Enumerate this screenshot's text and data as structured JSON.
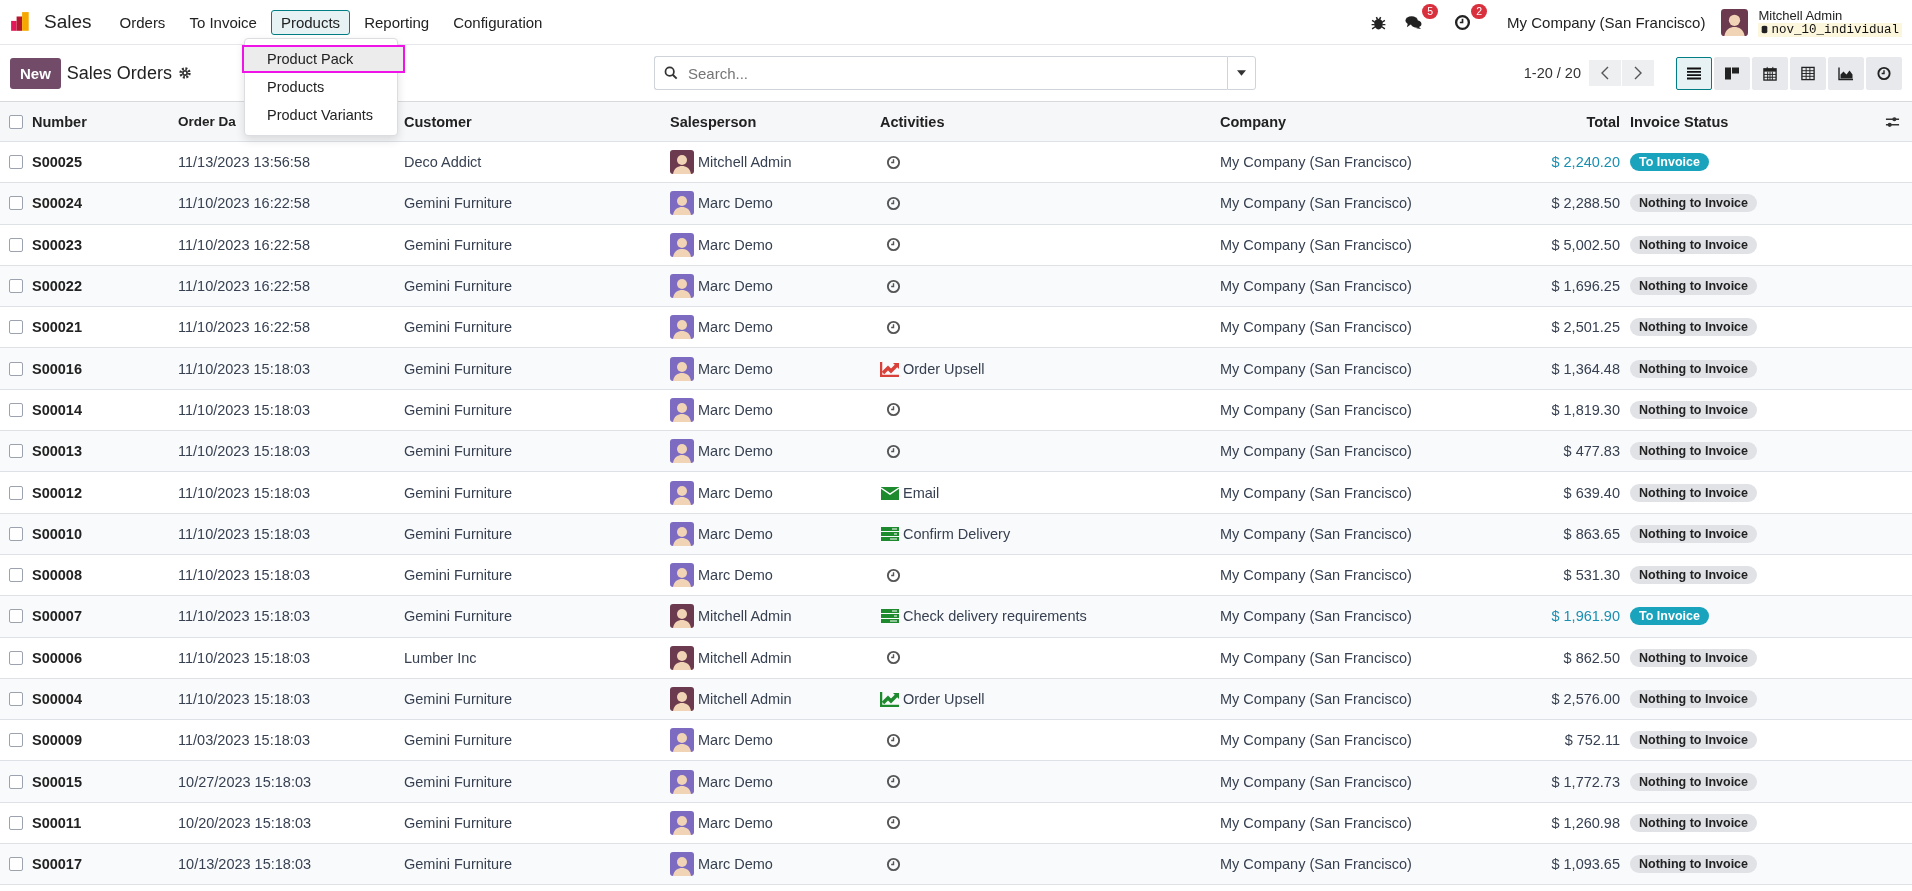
{
  "app": {
    "name": "Sales"
  },
  "menu": [
    {
      "label": "Orders",
      "selected": false
    },
    {
      "label": "To Invoice",
      "selected": false
    },
    {
      "label": "Products",
      "selected": true
    },
    {
      "label": "Reporting",
      "selected": false
    },
    {
      "label": "Configuration",
      "selected": false
    }
  ],
  "products_menu": [
    {
      "label": "Product Pack",
      "selected": true
    },
    {
      "label": "Products",
      "selected": false
    },
    {
      "label": "Product Variants",
      "selected": false
    }
  ],
  "systray": {
    "messages_count": "5",
    "activities_count": "2",
    "company": "My Company (San Francisco)",
    "user": "Mitchell Admin",
    "database": "nov_10_individual"
  },
  "control_panel": {
    "new_button": "New",
    "title": "Sales Orders",
    "search": {
      "placeholder": "Search..."
    },
    "pager": "1-20 / 20",
    "views": [
      {
        "kind": "list",
        "selected": true
      },
      {
        "kind": "kanban",
        "selected": false
      },
      {
        "kind": "calendar",
        "selected": false
      },
      {
        "kind": "pivot",
        "selected": false
      },
      {
        "kind": "graph",
        "selected": false
      },
      {
        "kind": "activity",
        "selected": false
      }
    ]
  },
  "table": {
    "select_all": {
      "checked": false
    },
    "columns": [
      "Number",
      "Order Da",
      "Customer",
      "Salesperson",
      "Activities",
      "Company",
      "Total",
      "Invoice Status"
    ],
    "rows": [
      {
        "checked": false,
        "number": "S00025",
        "order_date": "11/13/2023 13:56:58",
        "customer": "Deco Addict",
        "salesperson": "Mitchell Admin",
        "avatar": {
          "color": "#6b3a4f"
        },
        "activity": {
          "kind": "none"
        },
        "company": "My Company (San Francisco)",
        "total": "$ 2,240.20",
        "status": {
          "label": "To Invoice",
          "kind": "to_invoice"
        }
      },
      {
        "checked": false,
        "number": "S00024",
        "order_date": "11/10/2023 16:22:58",
        "customer": "Gemini Furniture",
        "salesperson": "Marc Demo",
        "avatar": {
          "color": "#7d6bc2"
        },
        "activity": {
          "kind": "none"
        },
        "company": "My Company (San Francisco)",
        "total": "$ 2,288.50",
        "status": {
          "label": "Nothing to Invoice",
          "kind": "nothing"
        }
      },
      {
        "checked": false,
        "number": "S00023",
        "order_date": "11/10/2023 16:22:58",
        "customer": "Gemini Furniture",
        "salesperson": "Marc Demo",
        "avatar": {
          "color": "#7d6bc2"
        },
        "activity": {
          "kind": "none"
        },
        "company": "My Company (San Francisco)",
        "total": "$ 5,002.50",
        "status": {
          "label": "Nothing to Invoice",
          "kind": "nothing"
        }
      },
      {
        "checked": false,
        "number": "S00022",
        "order_date": "11/10/2023 16:22:58",
        "customer": "Gemini Furniture",
        "salesperson": "Marc Demo",
        "avatar": {
          "color": "#7d6bc2"
        },
        "activity": {
          "kind": "none"
        },
        "company": "My Company (San Francisco)",
        "total": "$ 1,696.25",
        "status": {
          "label": "Nothing to Invoice",
          "kind": "nothing"
        }
      },
      {
        "checked": false,
        "number": "S00021",
        "order_date": "11/10/2023 16:22:58",
        "customer": "Gemini Furniture",
        "salesperson": "Marc Demo",
        "avatar": {
          "color": "#7d6bc2"
        },
        "activity": {
          "kind": "none"
        },
        "company": "My Company (San Francisco)",
        "total": "$ 2,501.25",
        "status": {
          "label": "Nothing to Invoice",
          "kind": "nothing"
        }
      },
      {
        "checked": false,
        "number": "S00016",
        "order_date": "11/10/2023 15:18:03",
        "customer": "Gemini Furniture",
        "salesperson": "Marc Demo",
        "avatar": {
          "color": "#7d6bc2"
        },
        "activity": {
          "kind": "upsell",
          "label": "Order Upsell",
          "color": "#d9403a"
        },
        "company": "My Company (San Francisco)",
        "total": "$ 1,364.48",
        "status": {
          "label": "Nothing to Invoice",
          "kind": "nothing"
        }
      },
      {
        "checked": false,
        "number": "S00014",
        "order_date": "11/10/2023 15:18:03",
        "customer": "Gemini Furniture",
        "salesperson": "Marc Demo",
        "avatar": {
          "color": "#7d6bc2"
        },
        "activity": {
          "kind": "none"
        },
        "company": "My Company (San Francisco)",
        "total": "$ 1,819.30",
        "status": {
          "label": "Nothing to Invoice",
          "kind": "nothing"
        }
      },
      {
        "checked": false,
        "number": "S00013",
        "order_date": "11/10/2023 15:18:03",
        "customer": "Gemini Furniture",
        "salesperson": "Marc Demo",
        "avatar": {
          "color": "#7d6bc2"
        },
        "activity": {
          "kind": "none"
        },
        "company": "My Company (San Francisco)",
        "total": "$ 477.83",
        "status": {
          "label": "Nothing to Invoice",
          "kind": "nothing"
        }
      },
      {
        "checked": false,
        "number": "S00012",
        "order_date": "11/10/2023 15:18:03",
        "customer": "Gemini Furniture",
        "salesperson": "Marc Demo",
        "avatar": {
          "color": "#7d6bc2"
        },
        "activity": {
          "kind": "email",
          "label": "Email",
          "color": "#1e8a2e"
        },
        "company": "My Company (San Francisco)",
        "total": "$ 639.40",
        "status": {
          "label": "Nothing to Invoice",
          "kind": "nothing"
        }
      },
      {
        "checked": false,
        "number": "S00010",
        "order_date": "11/10/2023 15:18:03",
        "customer": "Gemini Furniture",
        "salesperson": "Marc Demo",
        "avatar": {
          "color": "#7d6bc2"
        },
        "activity": {
          "kind": "todo",
          "label": "Confirm Delivery",
          "color": "#1e8a2e"
        },
        "company": "My Company (San Francisco)",
        "total": "$ 863.65",
        "status": {
          "label": "Nothing to Invoice",
          "kind": "nothing"
        }
      },
      {
        "checked": false,
        "number": "S00008",
        "order_date": "11/10/2023 15:18:03",
        "customer": "Gemini Furniture",
        "salesperson": "Marc Demo",
        "avatar": {
          "color": "#7d6bc2"
        },
        "activity": {
          "kind": "none"
        },
        "company": "My Company (San Francisco)",
        "total": "$ 531.30",
        "status": {
          "label": "Nothing to Invoice",
          "kind": "nothing"
        }
      },
      {
        "checked": false,
        "number": "S00007",
        "order_date": "11/10/2023 15:18:03",
        "customer": "Gemini Furniture",
        "salesperson": "Mitchell Admin",
        "avatar": {
          "color": "#6b3a4f"
        },
        "activity": {
          "kind": "todo",
          "label": "Check delivery requirements",
          "color": "#1e8a2e"
        },
        "company": "My Company (San Francisco)",
        "total": "$ 1,961.90",
        "status": {
          "label": "To Invoice",
          "kind": "to_invoice"
        }
      },
      {
        "checked": false,
        "number": "S00006",
        "order_date": "11/10/2023 15:18:03",
        "customer": "Lumber Inc",
        "salesperson": "Mitchell Admin",
        "avatar": {
          "color": "#6b3a4f"
        },
        "activity": {
          "kind": "none"
        },
        "company": "My Company (San Francisco)",
        "total": "$ 862.50",
        "status": {
          "label": "Nothing to Invoice",
          "kind": "nothing"
        }
      },
      {
        "checked": false,
        "number": "S00004",
        "order_date": "11/10/2023 15:18:03",
        "customer": "Gemini Furniture",
        "salesperson": "Mitchell Admin",
        "avatar": {
          "color": "#6b3a4f"
        },
        "activity": {
          "kind": "upsell",
          "label": "Order Upsell",
          "color": "#1e8a2e"
        },
        "company": "My Company (San Francisco)",
        "total": "$ 2,576.00",
        "status": {
          "label": "Nothing to Invoice",
          "kind": "nothing"
        }
      },
      {
        "checked": false,
        "number": "S00009",
        "order_date": "11/03/2023 15:18:03",
        "customer": "Gemini Furniture",
        "salesperson": "Marc Demo",
        "avatar": {
          "color": "#7d6bc2"
        },
        "activity": {
          "kind": "none"
        },
        "company": "My Company (San Francisco)",
        "total": "$ 752.11",
        "status": {
          "label": "Nothing to Invoice",
          "kind": "nothing"
        }
      },
      {
        "checked": false,
        "number": "S00015",
        "order_date": "10/27/2023 15:18:03",
        "customer": "Gemini Furniture",
        "salesperson": "Marc Demo",
        "avatar": {
          "color": "#7d6bc2"
        },
        "activity": {
          "kind": "none"
        },
        "company": "My Company (San Francisco)",
        "total": "$ 1,772.73",
        "status": {
          "label": "Nothing to Invoice",
          "kind": "nothing"
        }
      },
      {
        "checked": false,
        "number": "S00011",
        "order_date": "10/20/2023 15:18:03",
        "customer": "Gemini Furniture",
        "salesperson": "Marc Demo",
        "avatar": {
          "color": "#7d6bc2"
        },
        "activity": {
          "kind": "none"
        },
        "company": "My Company (San Francisco)",
        "total": "$ 1,260.98",
        "status": {
          "label": "Nothing to Invoice",
          "kind": "nothing"
        }
      },
      {
        "checked": false,
        "number": "S00017",
        "order_date": "10/13/2023 15:18:03",
        "customer": "Gemini Furniture",
        "salesperson": "Marc Demo",
        "avatar": {
          "color": "#7d6bc2"
        },
        "activity": {
          "kind": "none"
        },
        "company": "My Company (San Francisco)",
        "total": "$ 1,093.65",
        "status": {
          "label": "Nothing to Invoice",
          "kind": "nothing"
        }
      }
    ]
  }
}
